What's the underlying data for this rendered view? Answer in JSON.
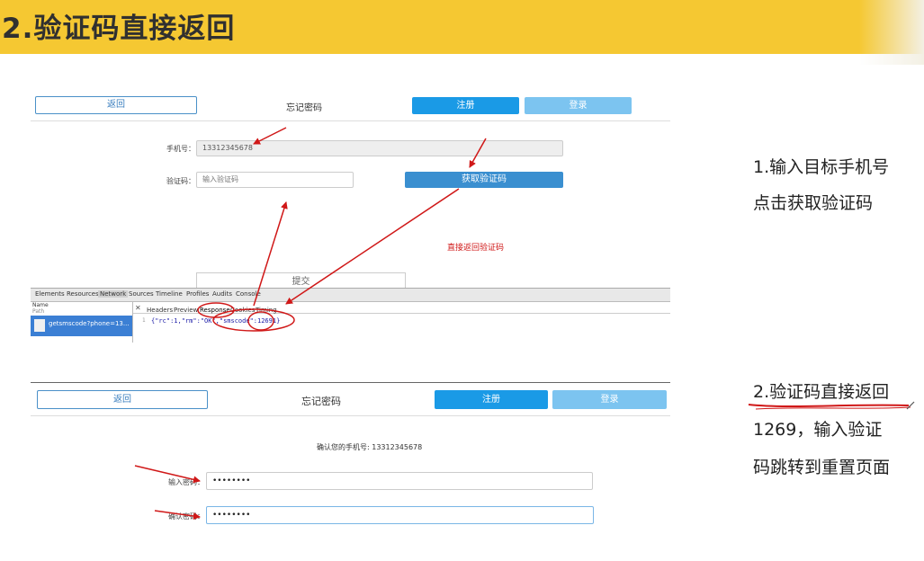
{
  "banner": {
    "title": "2.验证码直接返回"
  },
  "screen1": {
    "back_label": "返回",
    "title": "忘记密码",
    "register_label": "注册",
    "login_label": "登录",
    "phone_label": "手机号：",
    "phone_value": "13312345678",
    "code_label": "验证码：",
    "code_placeholder": "输入验证码",
    "get_code_label": "获取验证码",
    "annotation": "直接返回验证码",
    "submit_label": "提交"
  },
  "devtools": {
    "tabs": [
      "Elements",
      "Resources",
      "Network",
      "Sources",
      "Timeline",
      "Profiles",
      "Audits",
      "Console"
    ],
    "active_tab": "Network",
    "name_header": "Name",
    "path_header": "Path",
    "request_name": "getsmscode?phone=13...",
    "sub_tabs": [
      "Headers",
      "Preview",
      "Response",
      "Cookies",
      "Timing"
    ],
    "line_number": "1",
    "response_body": "{\"rc\":1,\"rm\":\"OK\",\"smscode\":12691}"
  },
  "screen2": {
    "back_label": "返回",
    "title": "忘记密码",
    "register_label": "注册",
    "login_label": "登录",
    "confirm_phone": "确认您的手机号: 13312345678",
    "password_label": "输入密码：",
    "password_value": "••••••••",
    "confirm_label": "确认密码：",
    "confirm_value": "••••••••"
  },
  "notes": {
    "step1_line1": "1.输入目标手机号",
    "step1_line2": "点击获取验证码",
    "step2_line1": "2.验证码直接返回",
    "step2_line2": "1269，输入验证",
    "step2_line3": "码跳转到重置页面"
  },
  "colors": {
    "banner": "#f5c832",
    "primary": "#1a9ae6",
    "annotation": "#d01818"
  }
}
